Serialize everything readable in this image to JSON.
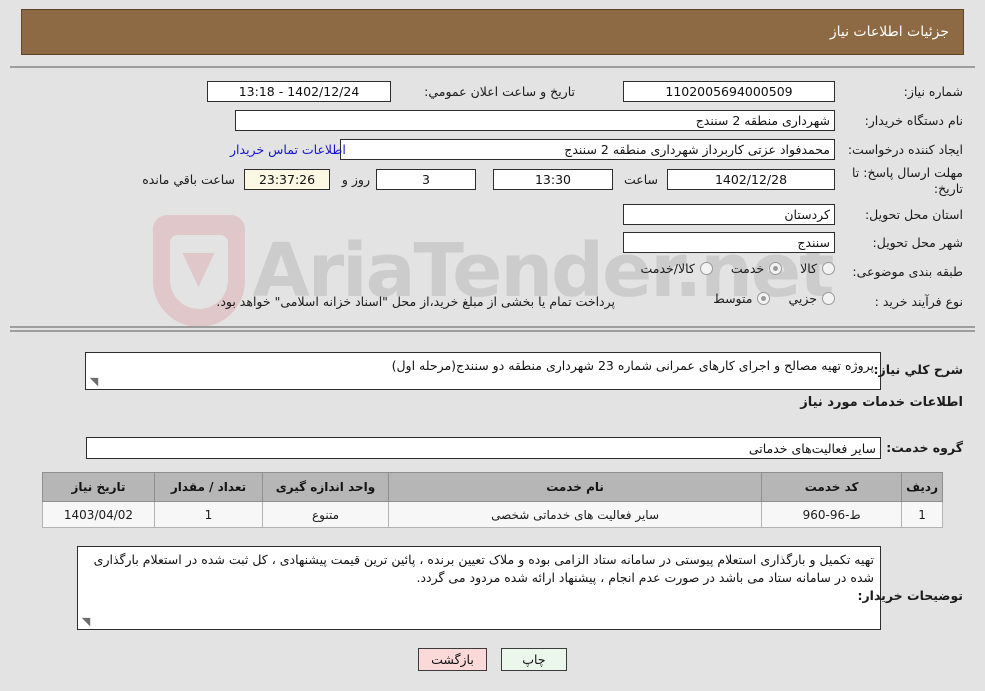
{
  "header": {
    "title": "جزئیات اطلاعات نیاز"
  },
  "watermark": {
    "text": "AriaTender.net"
  },
  "form": {
    "need_number": {
      "label": "شماره نیاز:",
      "value": "1102005694000509"
    },
    "buyer_org": {
      "label": "نام دستگاه خریدار:",
      "value": "شهرداری منطقه 2 سنندج"
    },
    "requester": {
      "label": "ایجاد کننده درخواست:",
      "value": "محمدفواد عزتی کاربرداز شهرداری منطقه 2 سنندج"
    },
    "deadline": {
      "label": "مهلت ارسال پاسخ: تا تاریخ:",
      "date": "1402/12/28",
      "time_label": "ساعت",
      "time": "13:30",
      "days": "3",
      "days_label": "روز و",
      "countdown": "23:37:26",
      "remaining_label": "ساعت باقي مانده"
    },
    "announce": {
      "label": "تاریخ و ساعت اعلان عمومي:",
      "value": "1402/12/24 - 13:18"
    },
    "empty_field": {
      "value": ""
    },
    "contact_link": {
      "label": "اطلاعات تماس خریدار"
    },
    "province": {
      "label": "استان محل تحویل:",
      "value": "کردستان"
    },
    "city": {
      "label": "شهر محل تحویل:",
      "value": "سنندج"
    },
    "category": {
      "label": "طبقه بندی موضوعی:",
      "options": [
        {
          "label": "کالا",
          "selected": false
        },
        {
          "label": "خدمت",
          "selected": true
        },
        {
          "label": "کالا/خدمت",
          "selected": false
        }
      ]
    },
    "purchase_type": {
      "label": "نوع فرآیند خرید :",
      "options": [
        {
          "label": "جزیي",
          "selected": false
        },
        {
          "label": "متوسط",
          "selected": true
        }
      ],
      "note": "پرداخت تمام یا بخشی از مبلغ خرید،از محل \"اسناد خزانه اسلامی\" خواهد بود."
    },
    "general_desc": {
      "label": "شرح کلي نیاز:",
      "value": "پروژه تهیه مصالح و اجرای کارهای عمرانی شماره 23 شهرداری منطقه دو سنندج(مرحله اول)"
    },
    "services_heading": "اطلاعات خدمات مورد نیاز",
    "service_group": {
      "label": "گروه خدمت:",
      "value": "سایر فعالیت‌های خدماتی"
    },
    "buyer_notes": {
      "label": "توضیحات خریدار:",
      "value": "تهیه  تکمیل و بارگذاری استعلام پیوستی در سامانه ستاد الزامی بوده و ملاک تعیین برنده ، پائین ترین قیمت پیشنهادی ، کل ثبت شده در استعلام بارگذاری شده در سامانه ستاد می باشد در صورت عدم انجام ، پیشنهاد ارائه شده مردود می گردد."
    }
  },
  "table": {
    "columns": [
      "ردیف",
      "کد خدمت",
      "نام خدمت",
      "واحد اندازه گیری",
      "تعداد / مقدار",
      "تاریخ نیاز"
    ],
    "rows": [
      {
        "row_no": "1",
        "code": "ط-96-960",
        "name": "سایر فعالیت های خدماتی شخصی",
        "unit": "متنوع",
        "qty": "1",
        "need_date": "1403/04/02"
      }
    ]
  },
  "buttons": {
    "print": "چاپ",
    "back": "بازگشت"
  }
}
